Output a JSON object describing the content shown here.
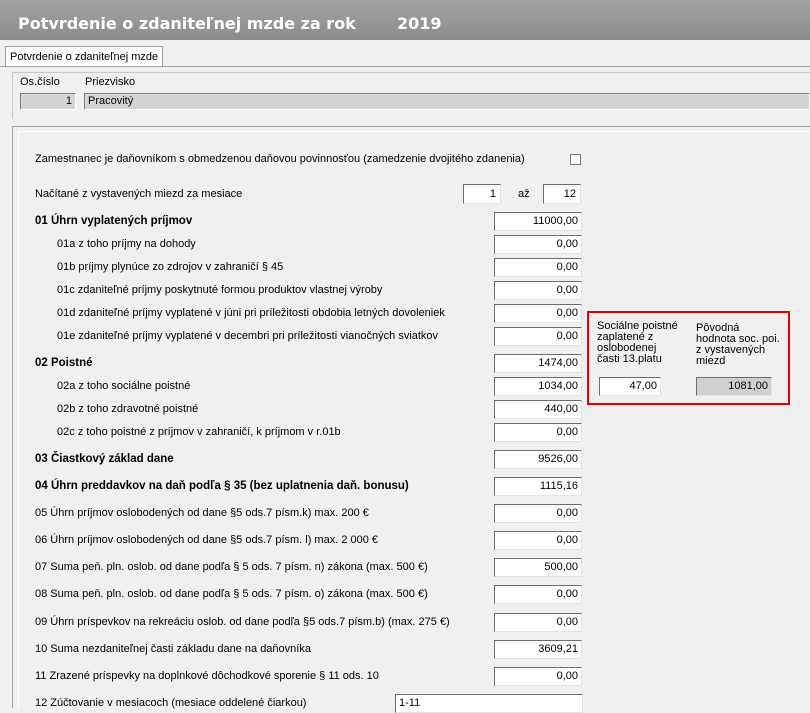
{
  "window": {
    "title": "Potvrdenie o zdaniteľnej mzde za rok",
    "year": "2019"
  },
  "tab": {
    "label": "Potvrdenie o zdaniteľnej mzde"
  },
  "employee": {
    "id_label": "Os.číslo",
    "surname_label": "Priezvisko",
    "id_value": "1",
    "surname_value": "Pracovitý"
  },
  "form": {
    "restricted_taxpayer_label": "Zamestnanec je daňovníkom s obmedzenou daňovou povinnosťou (zamedzenie dvojitého zdanenia)",
    "restricted_taxpayer_checked": false,
    "months_label": "Načítané z vystavených miezd za  mesiace",
    "month_from": "1",
    "month_sep": "až",
    "month_to": "12",
    "rows": [
      {
        "label": "01 Úhrn vyplatených príjmov",
        "value": "11000,00",
        "bold": true
      },
      {
        "label": "01a z toho príjmy na dohody",
        "value": "0,00"
      },
      {
        "label": "01b príjmy plynúce zo zdrojov v zahraničí § 45",
        "value": "0,00"
      },
      {
        "label": "01c zdaniteľné príjmy poskytnuté formou produktov vlastnej výroby",
        "value": "0,00"
      },
      {
        "label": "01d zdaniteľné príjmy vyplatené v júni pri príležitosti obdobia letných dovoleniek",
        "value": "0,00"
      },
      {
        "label": "01e zdaniteľné príjmy vyplatené v decembri pri príležitosti vianočných sviatkov",
        "value": "0,00"
      },
      {
        "label": "02 Poistné",
        "value": "1474,00",
        "bold": true
      },
      {
        "label": "02a  z toho sociálne poistné",
        "value": "1034,00"
      },
      {
        "label": "02b z toho zdravotné  poistné",
        "value": "440,00"
      },
      {
        "label": "02c z toho poistné z príjmov v zahraničí, k príjmom v r.01b",
        "value": "0,00"
      },
      {
        "label": "03 Čiastkový základ dane",
        "value": "9526,00",
        "bold": true
      },
      {
        "label": "04 Úhrn preddavkov na daň podľa § 35 (bez uplatnenia daň. bonusu)",
        "value": "1115,16",
        "bold": true
      },
      {
        "label": "05 Úhrn príjmov oslobodených od dane §5 ods.7 písm.k) max. 200 €",
        "value": "0,00"
      },
      {
        "label": "06 Úhrn príjmov oslobodených od dane §5 ods.7 písm. l) max. 2 000 €",
        "value": "0,00"
      },
      {
        "label": "07 Suma peň. pln. oslob. od dane podľa § 5 ods. 7 písm. n) zákona (max. 500 €)",
        "value": "500,00"
      },
      {
        "label": "08 Suma peň. pln. oslob. od dane podľa § 5 ods. 7 písm. o) zákona (max. 500 €)",
        "value": "0,00"
      },
      {
        "label": "09 Úhrn príspevkov na rekreáciu oslob. od dane podľa §5 ods.7 písm.b) (max. 275 €)",
        "value": "0,00"
      },
      {
        "label": "10 Suma nezdaniteľnej časti základu dane na daňovníka",
        "value": "3609,21"
      },
      {
        "label": "11 Zrazené príspevky na  doplnkové dôchodkové sporenie § 11 ods. 10",
        "value": "0,00"
      }
    ],
    "months_breakdown_label": "12 Zúčtovanie v mesiacoch (mesiace  oddelené čiarkou)",
    "months_breakdown_value": "1-11"
  },
  "callout": {
    "left_label": [
      "Sociálne poistné",
      "zaplatené z",
      "oslobodenej",
      "časti 13.platu"
    ],
    "right_label": [
      "Pôvodná",
      "hodnota soc. poi.",
      "z vystavených",
      "miezd"
    ],
    "left_value": "47,00",
    "right_value": "1081,00",
    "border_color": "#e00000"
  }
}
